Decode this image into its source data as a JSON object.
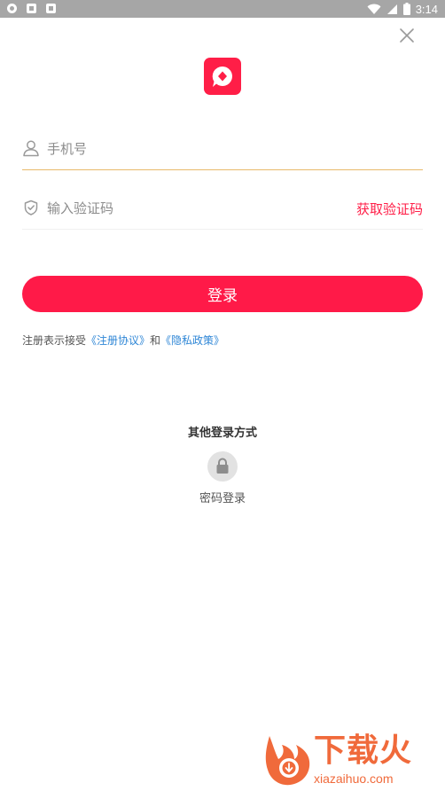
{
  "status_bar": {
    "time": "3:14",
    "icons": [
      "notification-icon",
      "sd-card-icon",
      "download-icon",
      "wifi-icon",
      "signal-icon",
      "battery-icon"
    ]
  },
  "form": {
    "phone_placeholder": "手机号",
    "code_placeholder": "输入验证码",
    "get_code_label": "获取验证码",
    "login_label": "登录"
  },
  "agreement": {
    "prefix": "注册表示接受",
    "terms_link": "《注册协议》",
    "conjunction": "和",
    "privacy_link": "《隐私政策》"
  },
  "other_login": {
    "title": "其他登录方式",
    "password_login_label": "密码登录"
  },
  "watermark": {
    "brand": "下载火",
    "url": "xiazaihuo.com"
  },
  "colors": {
    "accent": "#ff1e47",
    "link": "#2e86d6",
    "active_underline": "#e8b96a",
    "watermark": "#f06a3b"
  }
}
